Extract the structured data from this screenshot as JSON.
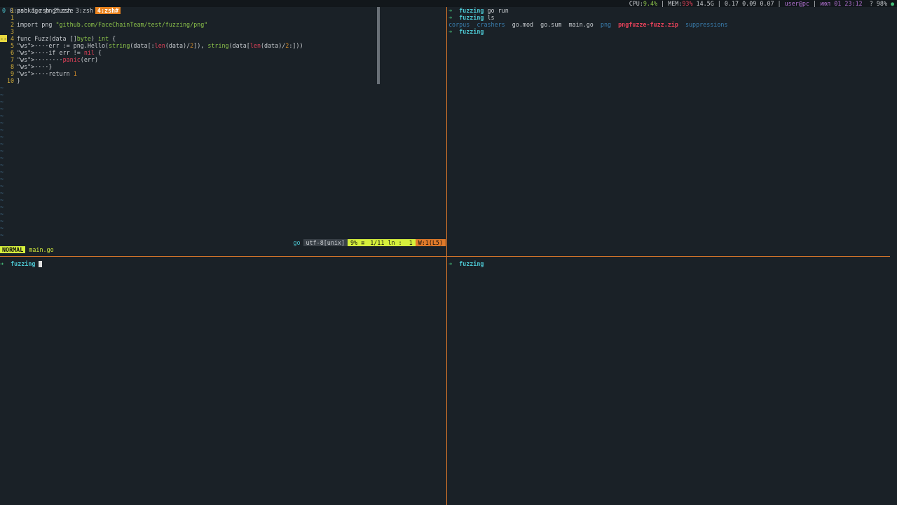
{
  "tmux": {
    "session": "0",
    "windows": [
      "0:zsh",
      "1:zsh",
      "2:zsh",
      "3:zsh"
    ],
    "active_window": "4:zsh#",
    "status": {
      "cpu_label": "CPU:",
      "cpu": "9.4%",
      "mem_label": "MEM:",
      "mem": "93%",
      "mem_size": "14.5G",
      "load": "0.17 0.09 0.07",
      "user": "user@pc",
      "date": "июл 01 23:12",
      "battery": "? 98%"
    }
  },
  "editor": {
    "lines": [
      {
        "n": "1",
        "t": "package pngfuzze"
      },
      {
        "n": "1",
        "t": ""
      },
      {
        "n": "2",
        "t": "import png \"github.com/FaceChainTeam/test/fuzzing/png\""
      },
      {
        "n": "3",
        "t": ""
      },
      {
        "n": "4",
        "t": "func Fuzz(data []byte) int {"
      },
      {
        "n": "5",
        "t": "    err := png.Hello(string(data[:len(data)/2]), string(data[len(data)/2:]))"
      },
      {
        "n": "6",
        "t": "    if err != nil {"
      },
      {
        "n": "7",
        "t": "        panic(err)"
      },
      {
        "n": "8",
        "t": "    }"
      },
      {
        "n": "9",
        "t": "    return 1"
      },
      {
        "n": "10",
        "t": "}"
      }
    ],
    "sign": "--",
    "status": {
      "mode": "NORMAL",
      "file": "main.go",
      "filetype": "go",
      "encoding": "utf-8[unix]",
      "percent": "9% ≡",
      "position": "1/11 ln :  1",
      "warning": "W:1(L5)"
    }
  },
  "shell_right": {
    "lines": [
      {
        "dir": "fuzzing",
        "cmd": "go run"
      },
      {
        "dir": "fuzzing",
        "cmd": "ls"
      }
    ],
    "ls": [
      {
        "name": "corpus",
        "color": "#3a7fb0"
      },
      {
        "name": "crashers",
        "color": "#3a7fb0"
      },
      {
        "name": "go.mod",
        "color": "#c8ccd0"
      },
      {
        "name": "go.sum",
        "color": "#c8ccd0"
      },
      {
        "name": "main.go",
        "color": "#c8ccd0"
      },
      {
        "name": "png",
        "color": "#3a7fb0"
      },
      {
        "name": "pngfuzze-fuzz.zip",
        "color": "#e8425a"
      },
      {
        "name": "suppressions",
        "color": "#3a7fb0"
      }
    ],
    "last_dir": "fuzzing"
  },
  "shell_bottom_left": {
    "dir": "fuzzing"
  },
  "shell_bottom_right": {
    "dir": "fuzzing"
  },
  "prompt_symbol": "➜"
}
